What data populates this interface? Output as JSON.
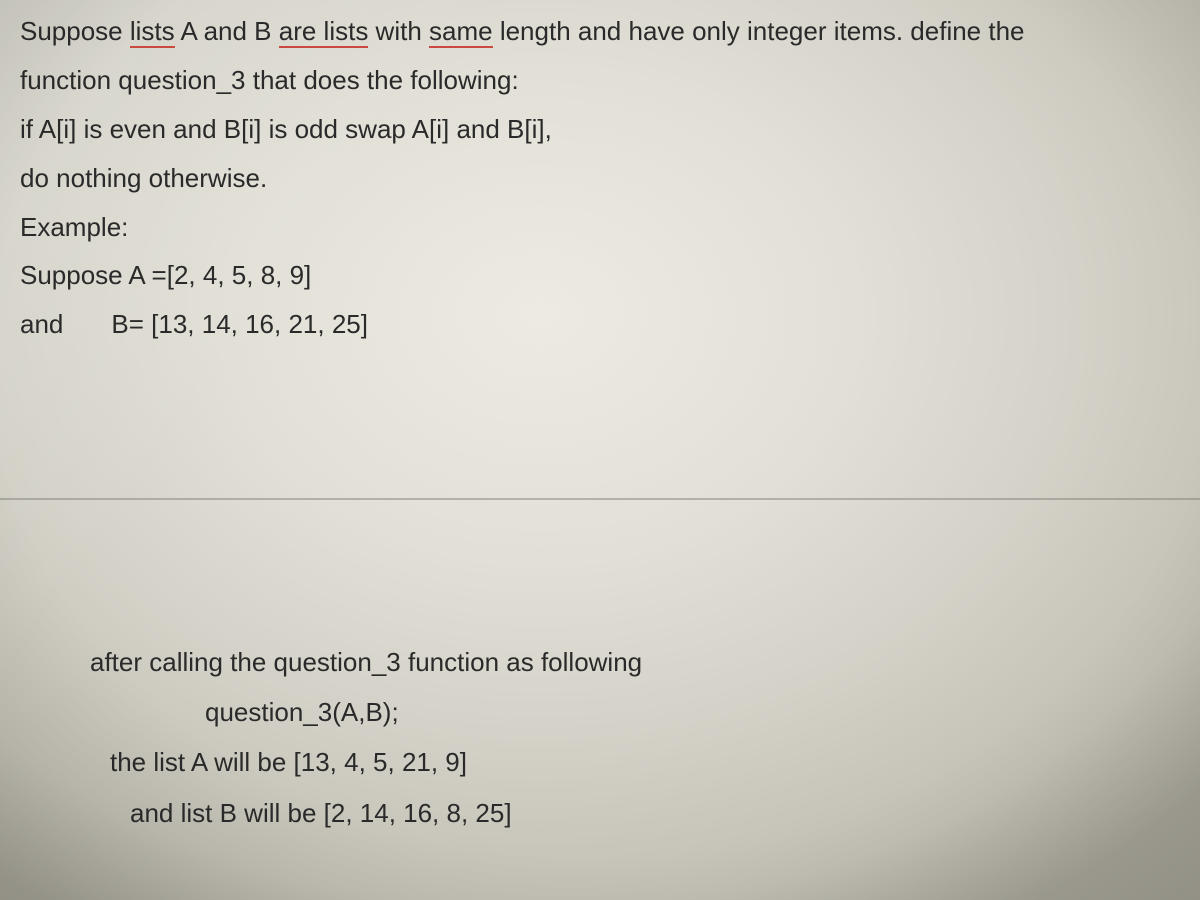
{
  "problem": {
    "line1_a": "Suppose ",
    "line1_b": "lists",
    "line1_c": " A and B ",
    "line1_d": "are lists",
    "line1_e": " with ",
    "line1_f": "same",
    "line1_g": " length and have only integer items. define the",
    "line2": "function question_3 that does the following:",
    "line3": "if A[i] is even and B[i] is odd swap A[i] and B[i],",
    "line4": "do nothing otherwise.",
    "example_label": "Example:",
    "example_a": "Suppose A =[2, 4, 5, 8, 9]",
    "example_b_and": "and",
    "example_b_val": "B= [13, 14, 16, 21, 25]"
  },
  "result": {
    "after_line": "after calling the question_3 function as following",
    "call_line": "question_3(A,B);",
    "res_a": "the list A will be [13, 4, 5, 21, 9]",
    "res_b": "and list B will be [2, 14, 16, 8, 25]"
  }
}
